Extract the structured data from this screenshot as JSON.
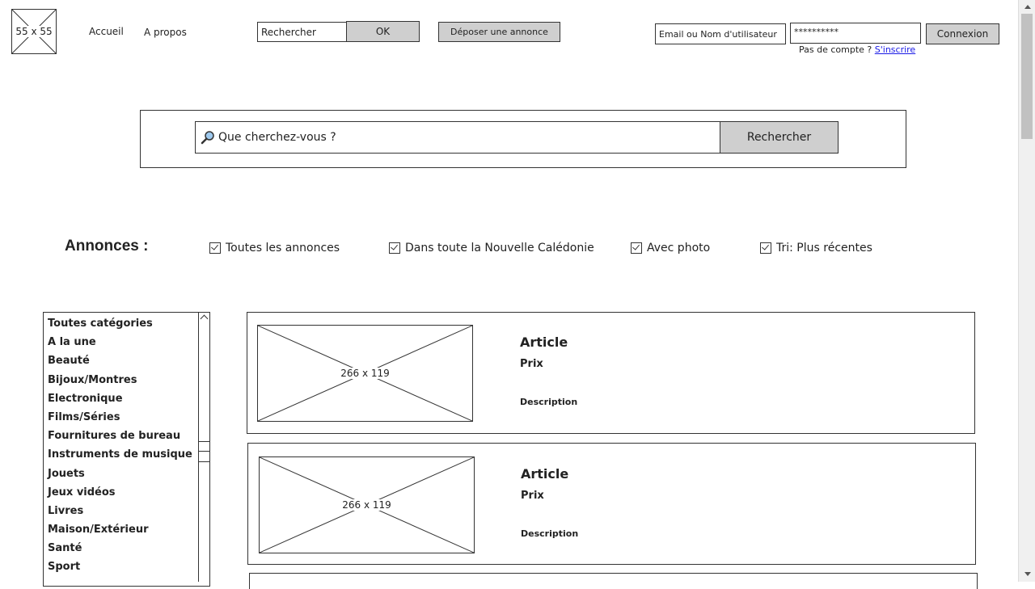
{
  "header": {
    "logo_label": "55 x 55",
    "nav": [
      "Accueil",
      "A propos"
    ],
    "search_placeholder": "Rechercher",
    "search_button": "OK",
    "post_ad_button": "Déposer une annonce",
    "login_user_placeholder": "Email ou Nom d'utilisateur",
    "login_password_value": "**********",
    "login_button": "Connexion",
    "signup_prompt": "Pas de compte ?",
    "signup_link": "S'inscrire"
  },
  "hero_search": {
    "placeholder": "Que cherchez-vous ?",
    "button": "Rechercher"
  },
  "filters": {
    "title": "Annonces :",
    "options": [
      {
        "label": "Toutes les annonces",
        "checked": true
      },
      {
        "label": "Dans toute la Nouvelle Calédonie",
        "checked": true
      },
      {
        "label": "Avec photo",
        "checked": true
      },
      {
        "label": "Tri: Plus récentes",
        "checked": true
      }
    ]
  },
  "categories": [
    "Toutes catégories",
    "A la une",
    "Beauté",
    "Bijoux/Montres",
    "Electronique",
    "Films/Séries",
    "Fournitures de bureau",
    "Instruments de musique",
    "Jouets",
    "Jeux vidéos",
    "Livres",
    "Maison/Extérieur",
    "Santé",
    "Sport"
  ],
  "listings": [
    {
      "image_label": "266 x 119",
      "title": "Article",
      "price": "Prix",
      "description": "Description"
    },
    {
      "image_label": "266 x 119",
      "title": "Article",
      "price": "Prix",
      "description": "Description"
    }
  ],
  "icons": {
    "search": "magnifier-icon",
    "scroll_up": "chevron-up-icon",
    "checkbox": "checkbox-checked-icon"
  }
}
